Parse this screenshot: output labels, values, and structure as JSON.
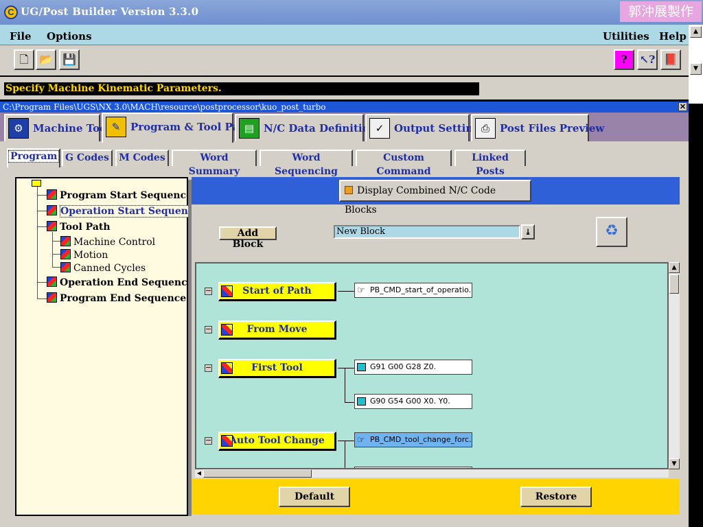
{
  "window": {
    "title": "UG/Post Builder Version 3.3.0",
    "watermark": "郭沖展製作"
  },
  "menu": {
    "file": "File",
    "options": "Options",
    "utilities": "Utilities",
    "help": "Help"
  },
  "toolbar": {
    "new_icon": "new-file-icon",
    "open_icon": "open-folder-icon",
    "save_icon": "save-disk-icon",
    "help_icon": "question-icon",
    "context_help_icon": "context-help-icon",
    "manual_icon": "manual-book-icon"
  },
  "status": "Specify Machine Kinematic Parameters.",
  "path": "C:\\Program Files\\UGS\\NX 3.0\\MACH\\resource\\postprocessor\\kuo_post_turbo",
  "main_tabs": [
    {
      "label": "Machine Tool",
      "icon": "machine-tool-icon"
    },
    {
      "label": "Program & Tool Path",
      "icon": "program-toolpath-icon"
    },
    {
      "label": "N/C Data Definitions",
      "icon": "nc-data-icon"
    },
    {
      "label": "Output Settings",
      "icon": "output-settings-icon"
    },
    {
      "label": "Post Files Preview",
      "icon": "printer-icon"
    }
  ],
  "sub_tabs": [
    "Program",
    "G Codes",
    "M Codes",
    "Word Summary",
    "Word Sequencing",
    "Custom Command",
    "Linked Posts"
  ],
  "tree": [
    {
      "label": "Program Start Sequence"
    },
    {
      "label": "Operation Start Sequence"
    },
    {
      "label": "Tool Path"
    },
    {
      "label": "Machine Control"
    },
    {
      "label": "Motion"
    },
    {
      "label": "Canned Cycles"
    },
    {
      "label": "Operation End Sequence"
    },
    {
      "label": "Program End Sequence"
    }
  ],
  "panel": {
    "combined_label": "Display Combined N/C Code Blocks",
    "add_block": "Add Block",
    "new_block_value": "New Block",
    "default_btn": "Default",
    "restore_btn": "Restore"
  },
  "events": [
    {
      "label": "Start of Path",
      "blocks": [
        "PB_CMD_start_of_operatio..."
      ]
    },
    {
      "label": "From Move",
      "blocks": []
    },
    {
      "label": "First Tool",
      "blocks": [
        "G91 G00 G28 Z0.",
        "G90 G54 G00 X0. Y0."
      ]
    },
    {
      "label": "Auto Tool Change",
      "blocks": [
        "PB_CMD_tool_change_forc..."
      ]
    }
  ]
}
